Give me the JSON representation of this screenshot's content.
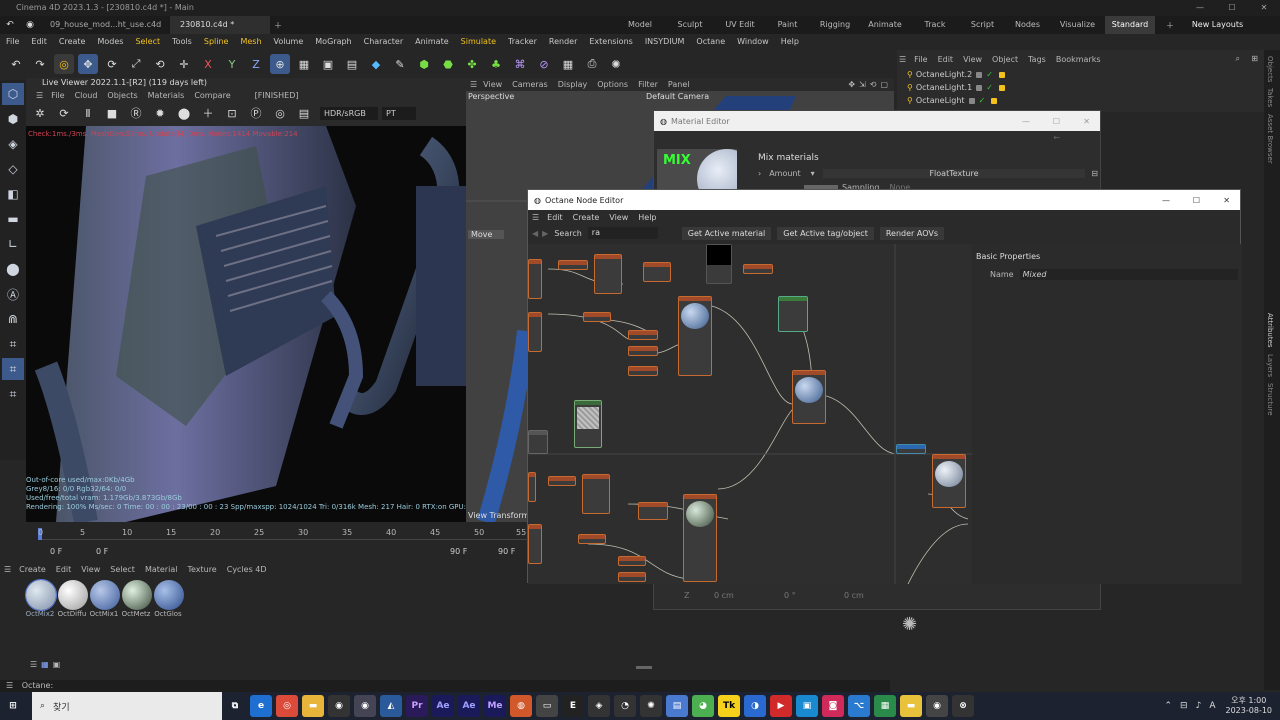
{
  "title": "Cinema 4D 2023.1.3 - [230810.c4d *] - Main",
  "doc_tabs": [
    "09_house_mod...ht_use.c4d *",
    "230810.c4d *"
  ],
  "layout_tabs": [
    "Model",
    "Sculpt",
    "UV Edit",
    "Paint",
    "Rigging",
    "Animate",
    "Track",
    "Script",
    "Nodes",
    "Visualize",
    "Standard",
    "New Layouts"
  ],
  "menu": [
    "File",
    "Edit",
    "Create",
    "Modes",
    "Select",
    "Tools",
    "Spline",
    "Mesh",
    "Volume",
    "MoGraph",
    "Character",
    "Animate",
    "Simulate",
    "Tracker",
    "Render",
    "Extensions",
    "INSYDIUM",
    "Octane",
    "Window",
    "Help"
  ],
  "live_viewer": {
    "title": "Live Viewer 2022.1.1-[R2] (119 days left)",
    "menu": [
      "File",
      "Cloud",
      "Objects",
      "Materials",
      "Compare"
    ],
    "status": "[FINISHED]",
    "color_mode": "HDR/sRGB",
    "render_mode": "PT",
    "check_line": "Check:1ms./3ms. MeshGen:52ms. Update[M]:0ms. Nodes:1414 Movable:214",
    "stats": [
      "Out-of-core used/max:0Kb/4Gb",
      "Grey8/16: 0/0        Rgb32/64: 0/0",
      "Used/free/total vram: 1.179Gb/3.873Gb/8Gb",
      "Rendering: 100% Ms/sec: 0   Time: 00 : 00 : 23/00 : 00 : 23   Spp/maxspp: 1024/1024   Tri: 0/316k   Mesh: 217   Hair: 0   RTX:on   GPU: 46"
    ]
  },
  "viewport": {
    "menu": [
      "View",
      "Cameras",
      "Display",
      "Options",
      "Filter",
      "Panel"
    ],
    "label": "Perspective",
    "camera": "Default Camera",
    "move_label": "Move",
    "view_transform": "View Transform:"
  },
  "objects": {
    "menu": [
      "File",
      "Edit",
      "View",
      "Object",
      "Tags",
      "Bookmarks"
    ],
    "items": [
      "OctaneLight.2",
      "OctaneLight.1",
      "OctaneLight"
    ]
  },
  "material_editor": {
    "title": "Material Editor",
    "preview_label": "MIX",
    "section": "Mix materials",
    "amount_label": "Amount",
    "amount_value": "FloatTexture",
    "sampling_label": "Sampling",
    "sampling_value": "None"
  },
  "node_editor": {
    "title": "Octane Node Editor",
    "menu": [
      "Edit",
      "Create",
      "View",
      "Help"
    ],
    "search_label": "Search",
    "search_value": "ra",
    "buttons": [
      "Get Active material",
      "Get Active tag/object",
      "Render AOVs"
    ],
    "props_title": "Basic Properties",
    "name_label": "Name",
    "name_value": "Mixed"
  },
  "timeline": {
    "ticks": [
      "0",
      "5",
      "10",
      "15",
      "20",
      "25",
      "30",
      "35",
      "40",
      "45",
      "50",
      "55"
    ],
    "start": "0 F",
    "current": "0 F",
    "end": "90 F",
    "end2": "90 F"
  },
  "material_manager": {
    "menu": [
      "Create",
      "Edit",
      "View",
      "Select",
      "Material",
      "Texture",
      "Cycles 4D"
    ],
    "materials": [
      "OctMix2",
      "OctDiffu",
      "OctMix1",
      "OctMetz",
      "OctGlos"
    ]
  },
  "coords": [
    "0 cm",
    "0 °",
    "0 cm"
  ],
  "status": "Octane:",
  "right_tabs": [
    "Objects",
    "Takes",
    "Asset Browser",
    "Attributes",
    "Layers",
    "Structure"
  ],
  "taskbar": {
    "search": "찾기",
    "time": "오후 1:00",
    "date": "2023-08-10"
  },
  "colors": {
    "accent": "#f3c21c",
    "layout_active": "#3a3a3a",
    "node_border": "#c76a30"
  }
}
